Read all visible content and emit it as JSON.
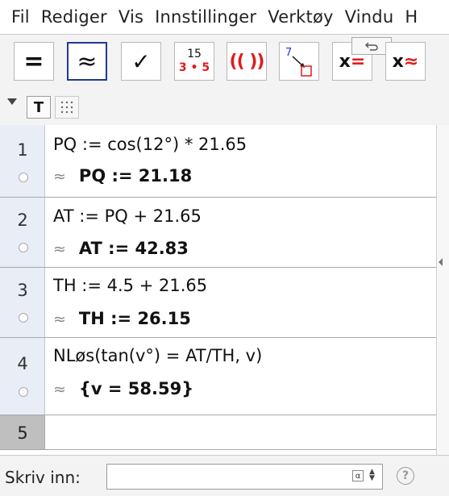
{
  "menu": [
    "Fil",
    "Rediger",
    "Vis",
    "Innstillinger",
    "Verktøy",
    "Vindu",
    "H"
  ],
  "toolbar": {
    "exact_symbol": "=",
    "numeric_symbol": "≈",
    "check_symbol": "✓",
    "factor_top": "15",
    "factor_bottom": "3 • 5",
    "expand_symbol": "(( ))",
    "substitute_number": "7",
    "solve_symbol": "x=",
    "nsolve_symbol": "x≈",
    "colors": {
      "red": "#e11b1b",
      "selected_border": "#1f3a93"
    }
  },
  "stylebar": {
    "text_button": "T"
  },
  "cas": {
    "rows": [
      {
        "num": "1",
        "input": "PQ := cos(12°) * 21.65",
        "approx": "≈",
        "output": "PQ := 21.18"
      },
      {
        "num": "2",
        "input": "AT := PQ + 21.65",
        "approx": "≈",
        "output": "AT := 42.83"
      },
      {
        "num": "3",
        "input": "TH := 4.5 + 21.65",
        "approx": "≈",
        "output": "TH := 26.15"
      },
      {
        "num": "4",
        "input": "NLøs(tan(v°) = AT/TH, v)",
        "approx": "≈",
        "output": "{v = 58.59}"
      },
      {
        "num": "5"
      }
    ]
  },
  "inputbar": {
    "label": "Skriv inn:",
    "value": "",
    "alpha": "α",
    "help": "?"
  }
}
